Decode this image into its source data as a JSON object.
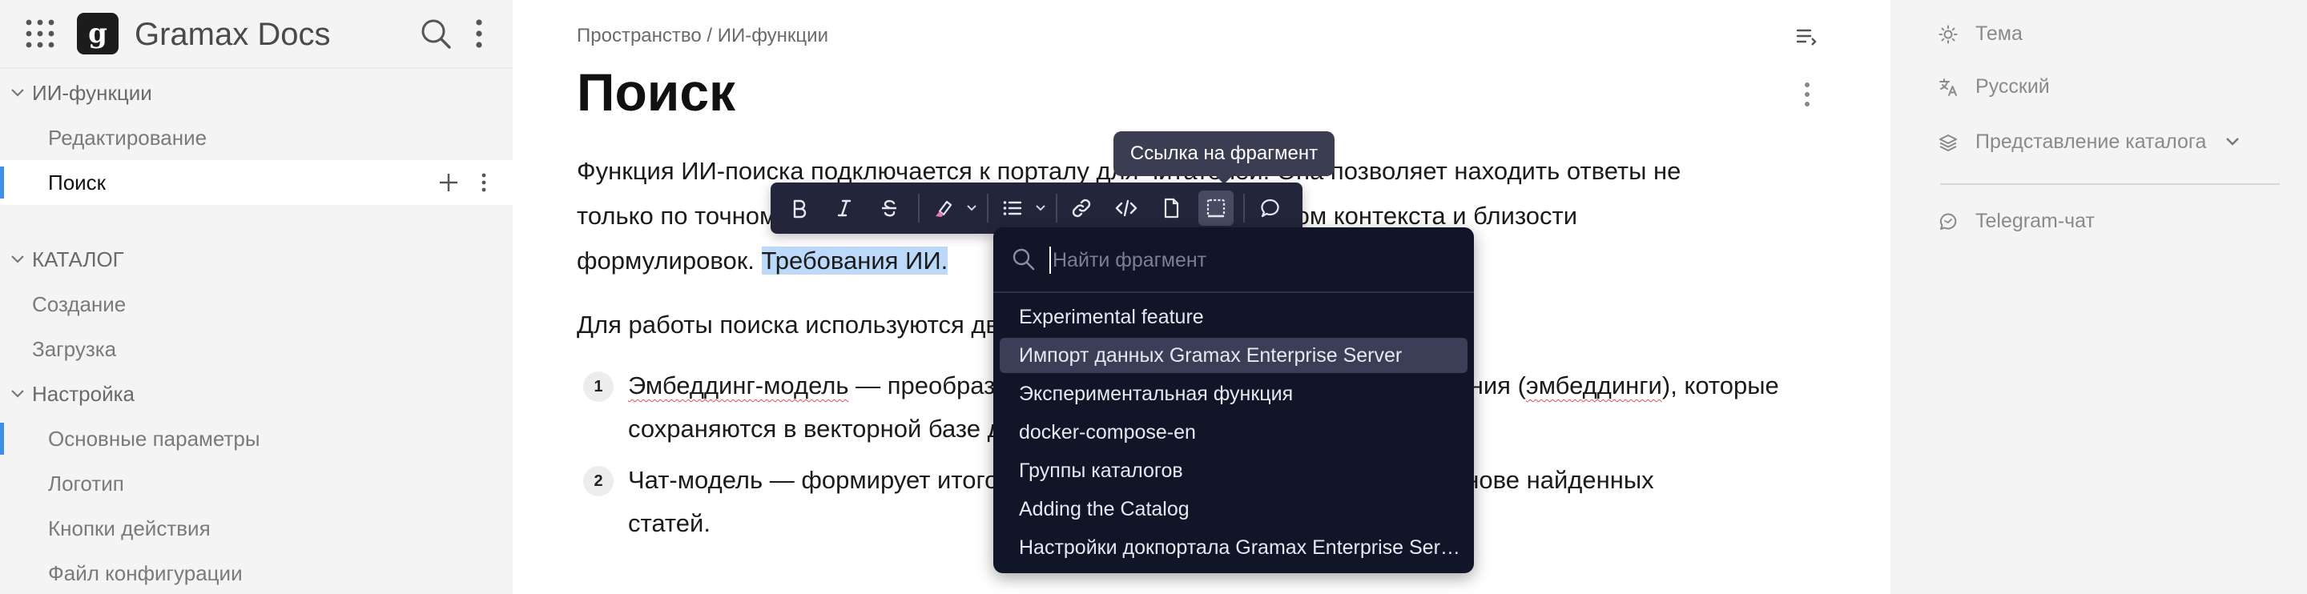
{
  "app": {
    "title": "Gramax Docs",
    "logo_letter": "g"
  },
  "sidebar": {
    "sections": [
      {
        "label": "ИИ-функции",
        "type": "group"
      },
      {
        "label": "Редактирование",
        "type": "child"
      },
      {
        "label": "Поиск",
        "type": "child-active"
      },
      {
        "label": "КАТАЛОГ",
        "type": "group"
      },
      {
        "label": "Создание",
        "type": "item"
      },
      {
        "label": "Загрузка",
        "type": "item"
      },
      {
        "label": "Настройка",
        "type": "group"
      },
      {
        "label": "Основные параметры",
        "type": "child-marked"
      },
      {
        "label": "Логотип",
        "type": "child"
      },
      {
        "label": "Кнопки действия",
        "type": "child"
      },
      {
        "label": "Файл конфигурации",
        "type": "child"
      }
    ]
  },
  "main": {
    "breadcrumb": "Пространство / ИИ-функции",
    "title": "Поиск",
    "para1": {
      "line1": "Функция ИИ-поиска подключается к порталу для читателей. Она позволяет находить ответы не",
      "line2": "только по точному совпадению слов, но и по смыслу — с учетом контекста и близости",
      "line3_plain": "формулировок. ",
      "line3_selected": "Требования ИИ."
    },
    "para2": "Для работы поиска используются две модели:",
    "list": [
      {
        "num": "1",
        "term": "Эмбеддинг-модель",
        "line1_rest": " — преобразует текст статей в векторные представления (",
        "wavy2": "эмбеддинги",
        "line1_end": "), которые",
        "line2": "сохраняются в векторной базе данных."
      },
      {
        "num": "2",
        "line1": "Чат-модель — формирует итоговый ответ на вопрос пользователя на основе найденных",
        "line2": "статей."
      }
    ]
  },
  "toolbar": {
    "tooltip": "Ссылка на фрагмент",
    "buttons": [
      "bold-icon",
      "italic-icon",
      "strikethrough-icon",
      "highlight-icon",
      "list-icon",
      "link-icon",
      "code-icon",
      "file-icon",
      "fragment-icon",
      "comment-icon"
    ]
  },
  "fragment_popup": {
    "placeholder": "Найти фрагмент",
    "items": [
      "Experimental feature",
      "Импорт данных Gramax Enterprise Server",
      "Экспериментальная функция",
      "docker-compose-en",
      "Группы каталогов",
      "Adding the Catalog",
      "Настройки докпортала Gramax Enterprise Server"
    ],
    "hover_index": 1
  },
  "rightbar": {
    "theme": "Тема",
    "language": "Русский",
    "catalog_view": "Представление каталога",
    "telegram": "Telegram-чат"
  },
  "colors": {
    "accent": "#3f8fe6",
    "selection": "#bcd9fa",
    "toolbar_bg": "#23263a",
    "popup_bg": "#111528"
  }
}
